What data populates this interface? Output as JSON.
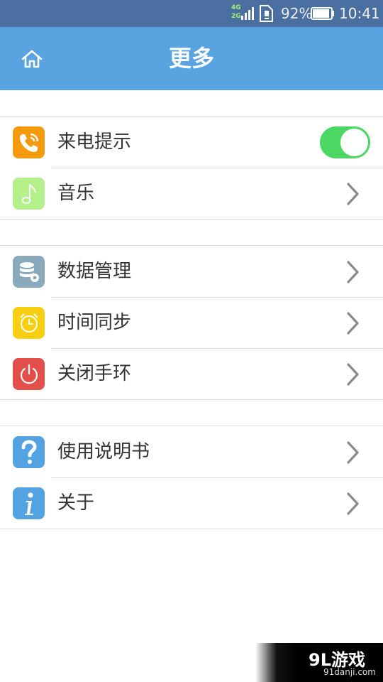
{
  "status_bar": {
    "network_top": "4G",
    "network_bottom": "2G",
    "battery_percent": "92%",
    "battery_level": 0.92,
    "time": "10:41"
  },
  "header": {
    "title": "更多",
    "home_icon": "home-icon"
  },
  "groups": [
    {
      "items": [
        {
          "label": "来电提示",
          "icon": "phone-ring-icon",
          "icon_color": "#f59a0c",
          "control": "toggle",
          "toggle_on": true
        },
        {
          "label": "音乐",
          "icon": "music-note-icon",
          "icon_color": "#b3f08a",
          "control": "chevron"
        }
      ]
    },
    {
      "items": [
        {
          "label": "数据管理",
          "icon": "database-settings-icon",
          "icon_color": "#8aa9bd",
          "control": "chevron"
        },
        {
          "label": "时间同步",
          "icon": "alarm-clock-icon",
          "icon_color": "#f8cf10",
          "control": "chevron"
        },
        {
          "label": "关闭手环",
          "icon": "power-icon",
          "icon_color": "#e3504c",
          "control": "chevron"
        }
      ]
    },
    {
      "items": [
        {
          "label": "使用说明书",
          "icon": "help-icon",
          "icon_color": "#53a3e2",
          "control": "chevron"
        },
        {
          "label": "关于",
          "icon": "info-icon",
          "icon_color": "#53a3e2",
          "control": "chevron"
        }
      ]
    }
  ],
  "colors": {
    "status_bar": "#4a6fa0",
    "header": "#58a3e0",
    "toggle_on": "#4bd763",
    "chevron": "#8a8a8a"
  },
  "watermark": {
    "logo": "9L游戏",
    "url": "91danji.com"
  }
}
